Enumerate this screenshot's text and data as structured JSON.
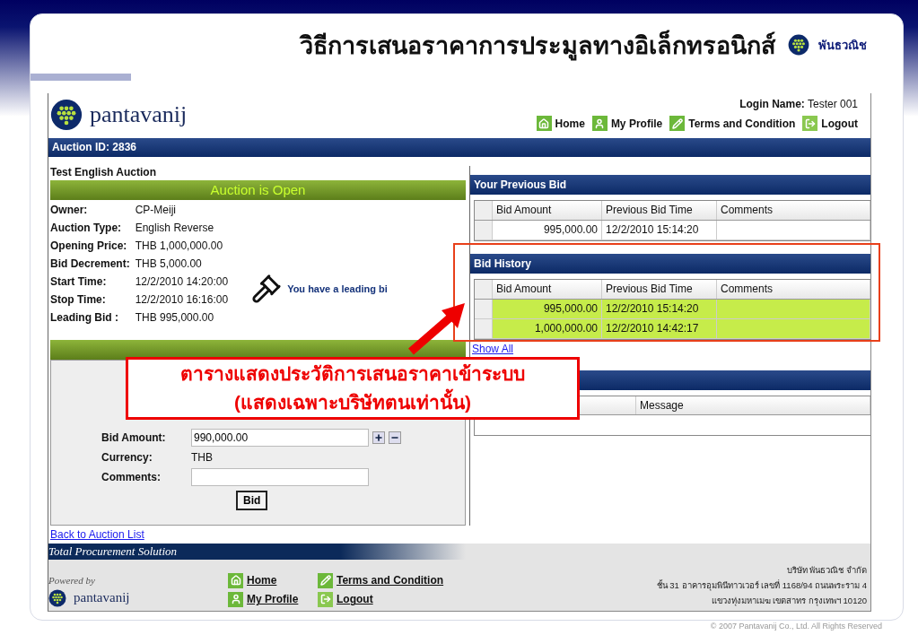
{
  "slide": {
    "title": "วิธีการเสนอราคาการประมูลทางอิเล็กทรอนิกส์",
    "brand": "พันธวณิช",
    "copyright": "© 2007 Pantavanij Co., Ltd. All Rights Reserved"
  },
  "header": {
    "logo_text": "pantavanij",
    "login_label": "Login Name:",
    "login_value": "Tester 001",
    "nav": [
      {
        "label": "Home"
      },
      {
        "label": "My Profile"
      },
      {
        "label": "Terms and Condition"
      },
      {
        "label": "Logout"
      }
    ]
  },
  "auction_bar": "Auction ID: 2836",
  "auction": {
    "title": "Test English Auction",
    "status": "Auction is Open",
    "details": [
      {
        "label": "Owner:",
        "value": "CP-Meiji"
      },
      {
        "label": "Auction Type:",
        "value": "English Reverse"
      },
      {
        "label": "Opening Price:",
        "value": "THB 1,000,000.00"
      },
      {
        "label": "Bid Decrement:",
        "value": "THB 5,000.00"
      },
      {
        "label": "Start Time:",
        "value": "12/2/2010 14:20:00"
      },
      {
        "label": "Stop Time:",
        "value": "12/2/2010 16:16:00"
      },
      {
        "label": "Leading Bid :",
        "value": "THB 995,000.00"
      }
    ],
    "leading_message": "You have a leading bi"
  },
  "bid_form": {
    "fields": [
      {
        "kind": "amount",
        "label": "Bid Amount:",
        "value": "990,000.00"
      },
      {
        "kind": "text",
        "label": "Currency:",
        "value": "THB"
      },
      {
        "kind": "input",
        "label": "Comments:"
      }
    ],
    "button": "Bid"
  },
  "back_link": "Back to Auction List",
  "previous_bid": {
    "title": "Your Previous Bid",
    "columns": [
      "Bid Amount",
      "Previous Bid Time",
      "Comments"
    ],
    "rows": [
      {
        "amount": "995,000.00",
        "time": "12/2/2010 15:14:20",
        "highlighted": false
      }
    ]
  },
  "bid_history": {
    "title": "Bid History",
    "columns": [
      "Bid Amount",
      "Previous Bid Time",
      "Comments"
    ],
    "rows": [
      {
        "amount": "995,000.00",
        "time": "12/2/2010 15:14:20",
        "highlighted": true
      },
      {
        "amount": "1,000,000.00",
        "time": "12/2/2010 14:42:17",
        "highlighted": true
      }
    ],
    "show_all": "Show All"
  },
  "messages": {
    "columns": [
      "Message"
    ]
  },
  "footer": {
    "tagline": "Total Procurement Solution",
    "powered_by": "Powered by",
    "logo_text": "pantavanij",
    "links": [
      {
        "label": "Home"
      },
      {
        "label": "Terms and Condition"
      },
      {
        "label": "My Profile"
      },
      {
        "label": "Logout"
      }
    ],
    "address": [
      "บริษัท พันธวณิช จำกัด",
      "ชั้น 31 อาคารอุมพินีทาวเวอร์ เลขที่ 1168/94 ถนนพระราม 4",
      "แขวงทุ่งมหาเมฆ เขตสาทร กรุงเทพฯ 10120"
    ]
  },
  "callout": {
    "lines": [
      "ตารางแสดงประวัติการเสนอราคาเข้าระบบ",
      "(แสดงเฉพาะบริษัทตนเท่านั้น)"
    ]
  }
}
